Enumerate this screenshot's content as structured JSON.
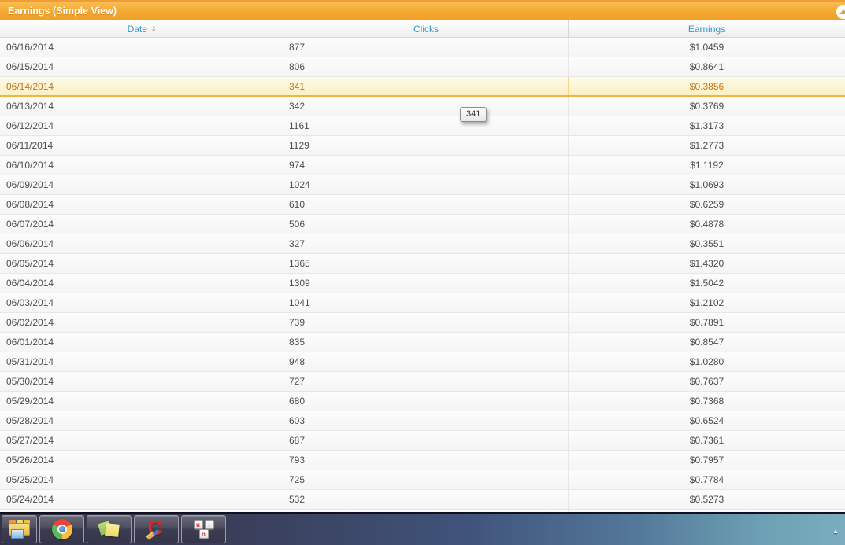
{
  "panel": {
    "title": "Earnings (Simple View)",
    "sort_up_glyph": "▲",
    "sort_down_glyph": "▼"
  },
  "colors": {
    "title_bar_orange": "#F4A82F",
    "header_text_blue": "#3399CC",
    "selected_row_bg": "#FBF0C3",
    "selected_row_text": "#C1761F",
    "selected_row_border": "#F2B43C"
  },
  "table": {
    "columns": [
      {
        "label": "Date",
        "sortable": true
      },
      {
        "label": "Clicks",
        "sortable": true
      },
      {
        "label": "Earnings",
        "sortable": true
      }
    ],
    "selected_row_index": 2,
    "rows": [
      {
        "date": "06/16/2014",
        "clicks": "877",
        "earnings": "$1.0459"
      },
      {
        "date": "06/15/2014",
        "clicks": "806",
        "earnings": "$0.8641"
      },
      {
        "date": "06/14/2014",
        "clicks": "341",
        "earnings": "$0.3856"
      },
      {
        "date": "06/13/2014",
        "clicks": "342",
        "earnings": "$0.3769"
      },
      {
        "date": "06/12/2014",
        "clicks": "1161",
        "earnings": "$1.3173"
      },
      {
        "date": "06/11/2014",
        "clicks": "1129",
        "earnings": "$1.2773"
      },
      {
        "date": "06/10/2014",
        "clicks": "974",
        "earnings": "$1.1192"
      },
      {
        "date": "06/09/2014",
        "clicks": "1024",
        "earnings": "$1.0693"
      },
      {
        "date": "06/08/2014",
        "clicks": "610",
        "earnings": "$0.6259"
      },
      {
        "date": "06/07/2014",
        "clicks": "506",
        "earnings": "$0.4878"
      },
      {
        "date": "06/06/2014",
        "clicks": "327",
        "earnings": "$0.3551"
      },
      {
        "date": "06/05/2014",
        "clicks": "1365",
        "earnings": "$1.4320"
      },
      {
        "date": "06/04/2014",
        "clicks": "1309",
        "earnings": "$1.5042"
      },
      {
        "date": "06/03/2014",
        "clicks": "1041",
        "earnings": "$1.2102"
      },
      {
        "date": "06/02/2014",
        "clicks": "739",
        "earnings": "$0.7891"
      },
      {
        "date": "06/01/2014",
        "clicks": "835",
        "earnings": "$0.8547"
      },
      {
        "date": "05/31/2014",
        "clicks": "948",
        "earnings": "$1.0280"
      },
      {
        "date": "05/30/2014",
        "clicks": "727",
        "earnings": "$0.7637"
      },
      {
        "date": "05/29/2014",
        "clicks": "680",
        "earnings": "$0.7368"
      },
      {
        "date": "05/28/2014",
        "clicks": "603",
        "earnings": "$0.6524"
      },
      {
        "date": "05/27/2014",
        "clicks": "687",
        "earnings": "$0.7361"
      },
      {
        "date": "05/26/2014",
        "clicks": "793",
        "earnings": "$0.7957"
      },
      {
        "date": "05/25/2014",
        "clicks": "725",
        "earnings": "$0.7784"
      },
      {
        "date": "05/24/2014",
        "clicks": "532",
        "earnings": "$0.5273"
      }
    ]
  },
  "tooltip": {
    "text": "341"
  },
  "taskbar": {
    "items": [
      {
        "name": "windows-explorer"
      },
      {
        "name": "google-chrome"
      },
      {
        "name": "sticky-notes"
      },
      {
        "name": "ccleaner"
      },
      {
        "name": "uin-keys",
        "key_labels": [
          "u",
          "i",
          "n"
        ]
      }
    ],
    "tray_arrow_glyph": "▲"
  }
}
